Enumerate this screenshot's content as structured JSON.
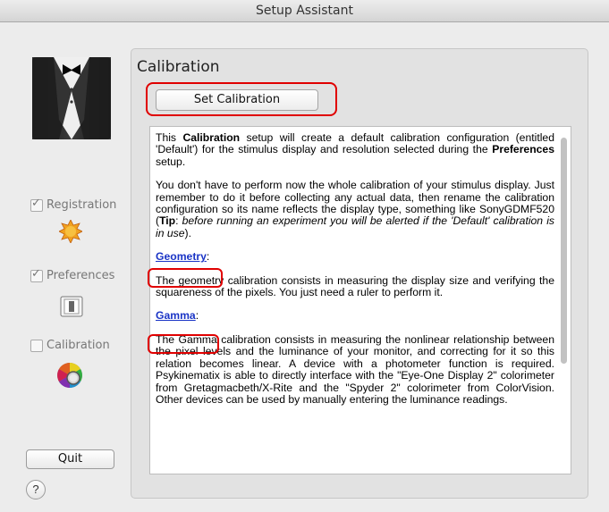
{
  "window": {
    "title": "Setup Assistant"
  },
  "sidebar": {
    "steps": [
      {
        "label": "Registration",
        "checked": true,
        "icon": "badge-icon"
      },
      {
        "label": "Preferences",
        "checked": true,
        "icon": "switch-icon"
      },
      {
        "label": "Calibration",
        "checked": false,
        "icon": "color-wheel-icon"
      }
    ],
    "quit_label": "Quit",
    "help_label": "?"
  },
  "main": {
    "title": "Calibration",
    "set_calibration_label": "Set Calibration",
    "intro": {
      "t1": "This ",
      "b1": "Calibration",
      "t2": " setup will create a default calibration configuration (entitled 'Default') for the stimulus display and resolution selected during the ",
      "b2": "Preferences",
      "t3": " setup."
    },
    "para2": {
      "t1": "You don't have to perform now the whole calibration of your stimulus display. Just remember to do it before collecting any actual data, then rename the calibration configuration so its name reflects the display type, something like SonyGDMF520 (",
      "tip": "Tip",
      "t2": ": ",
      "italic": "before running an experiment you will be alerted if the 'Default' calibration is in use",
      "t3": ")."
    },
    "geometry": {
      "link": "Geometry",
      "colon": ":",
      "text": "The geometry calibration consists in measuring the display size and verifying the squareness of the pixels. You just need a ruler to perform it."
    },
    "gamma": {
      "link": "Gamma",
      "colon": ":",
      "text": "The Gamma calibration consists in measuring the nonlinear relationship between the pixel levels and the luminance of your monitor, and correcting for it so this relation becomes linear. A device with a photometer function is required. Psykinematix is able to directly interface with the \"Eye-One Display 2\" colorimeter from Gretagmacbeth/X-Rite and the \"Spyder 2\" colorimeter from ColorVision. Other devices can be used by manually entering the luminance readings."
    }
  },
  "colors": {
    "highlight": "#e00000",
    "link": "#1a34c6"
  }
}
